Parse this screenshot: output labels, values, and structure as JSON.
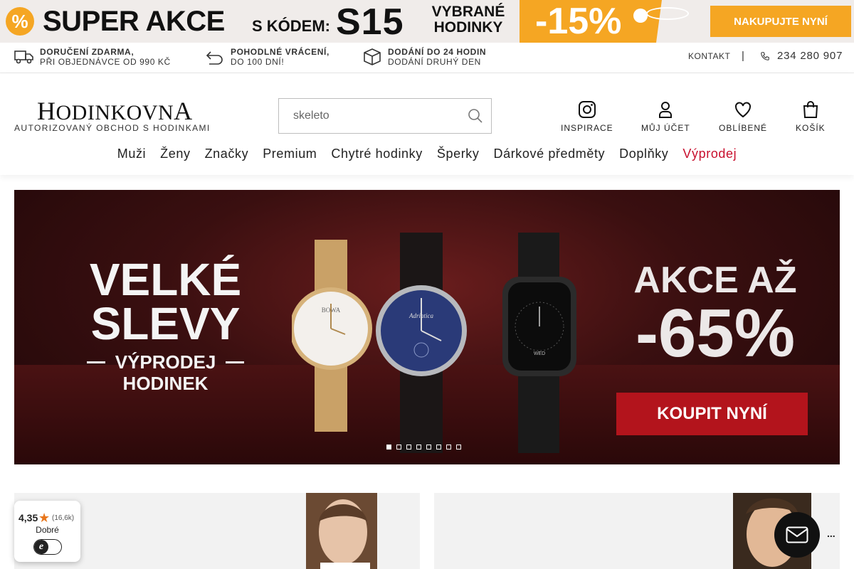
{
  "promo": {
    "percent_icon": "%",
    "title": "SUPER AKCE",
    "code_label": "S KÓDEM:",
    "code": "S15",
    "selection_line1": "VYBRANÉ",
    "selection_line2": "HODINKY",
    "discount": "-15%",
    "cta": "NAKUPUJTE NYNÍ",
    "accent_color": "#f5a623"
  },
  "benefits": [
    {
      "icon": "delivery-truck-icon",
      "title": "DORUČENÍ ZDARMA,",
      "subtitle": "PŘI OBJEDNÁVCE OD 990 KČ"
    },
    {
      "icon": "return-arrow-icon",
      "title": "POHODLNÉ VRÁCENÍ,",
      "subtitle": "DO 100 DNÍ!"
    },
    {
      "icon": "package-box-icon",
      "title": "DODÁNÍ DO 24 HODIN",
      "subtitle": "DODÁNÍ DRUHÝ DEN"
    }
  ],
  "contact": {
    "label": "KONTAKT",
    "separator": "|",
    "phone": "234 280 907"
  },
  "header": {
    "logo_first": "H",
    "logo_middle": "ODINKOVN",
    "logo_last": "A",
    "tagline": "AUTORIZOVANÝ OBCHOD S HODINKAMI",
    "search_placeholder": "skeleto",
    "actions": [
      {
        "icon": "instagram-icon",
        "label": "INSPIRACE"
      },
      {
        "icon": "user-icon",
        "label": "MŮJ ÚČET"
      },
      {
        "icon": "heart-icon",
        "label": "OBLÍBENÉ"
      },
      {
        "icon": "shopping-bag-icon",
        "label": "KOŠÍK"
      }
    ]
  },
  "nav": {
    "items": [
      "Muži",
      "Ženy",
      "Značky",
      "Premium",
      "Chytré hodinky",
      "Šperky",
      "Dárkové předměty",
      "Doplňky"
    ],
    "sale": "Výprodej",
    "sale_color": "#c8102e"
  },
  "hero": {
    "headline1": "VELKÉ",
    "headline2": "SLEVY",
    "sub1": "VÝPRODEJ",
    "sub2": "HODINEK",
    "offer_line": "AKCE AŽ",
    "offer_value": "-65%",
    "cta": "KOUPIT NYNÍ",
    "slide_count": 8,
    "active_slide": 1,
    "watch_brands": [
      "BOWA",
      "Adriatica"
    ],
    "smartwatch_date": "WED",
    "cta_color": "#b3141c"
  },
  "rating": {
    "score": "4,35",
    "count": "(16,6k)",
    "word": "Dobré",
    "logo_letter": "e"
  },
  "chat": {
    "more": "..."
  }
}
